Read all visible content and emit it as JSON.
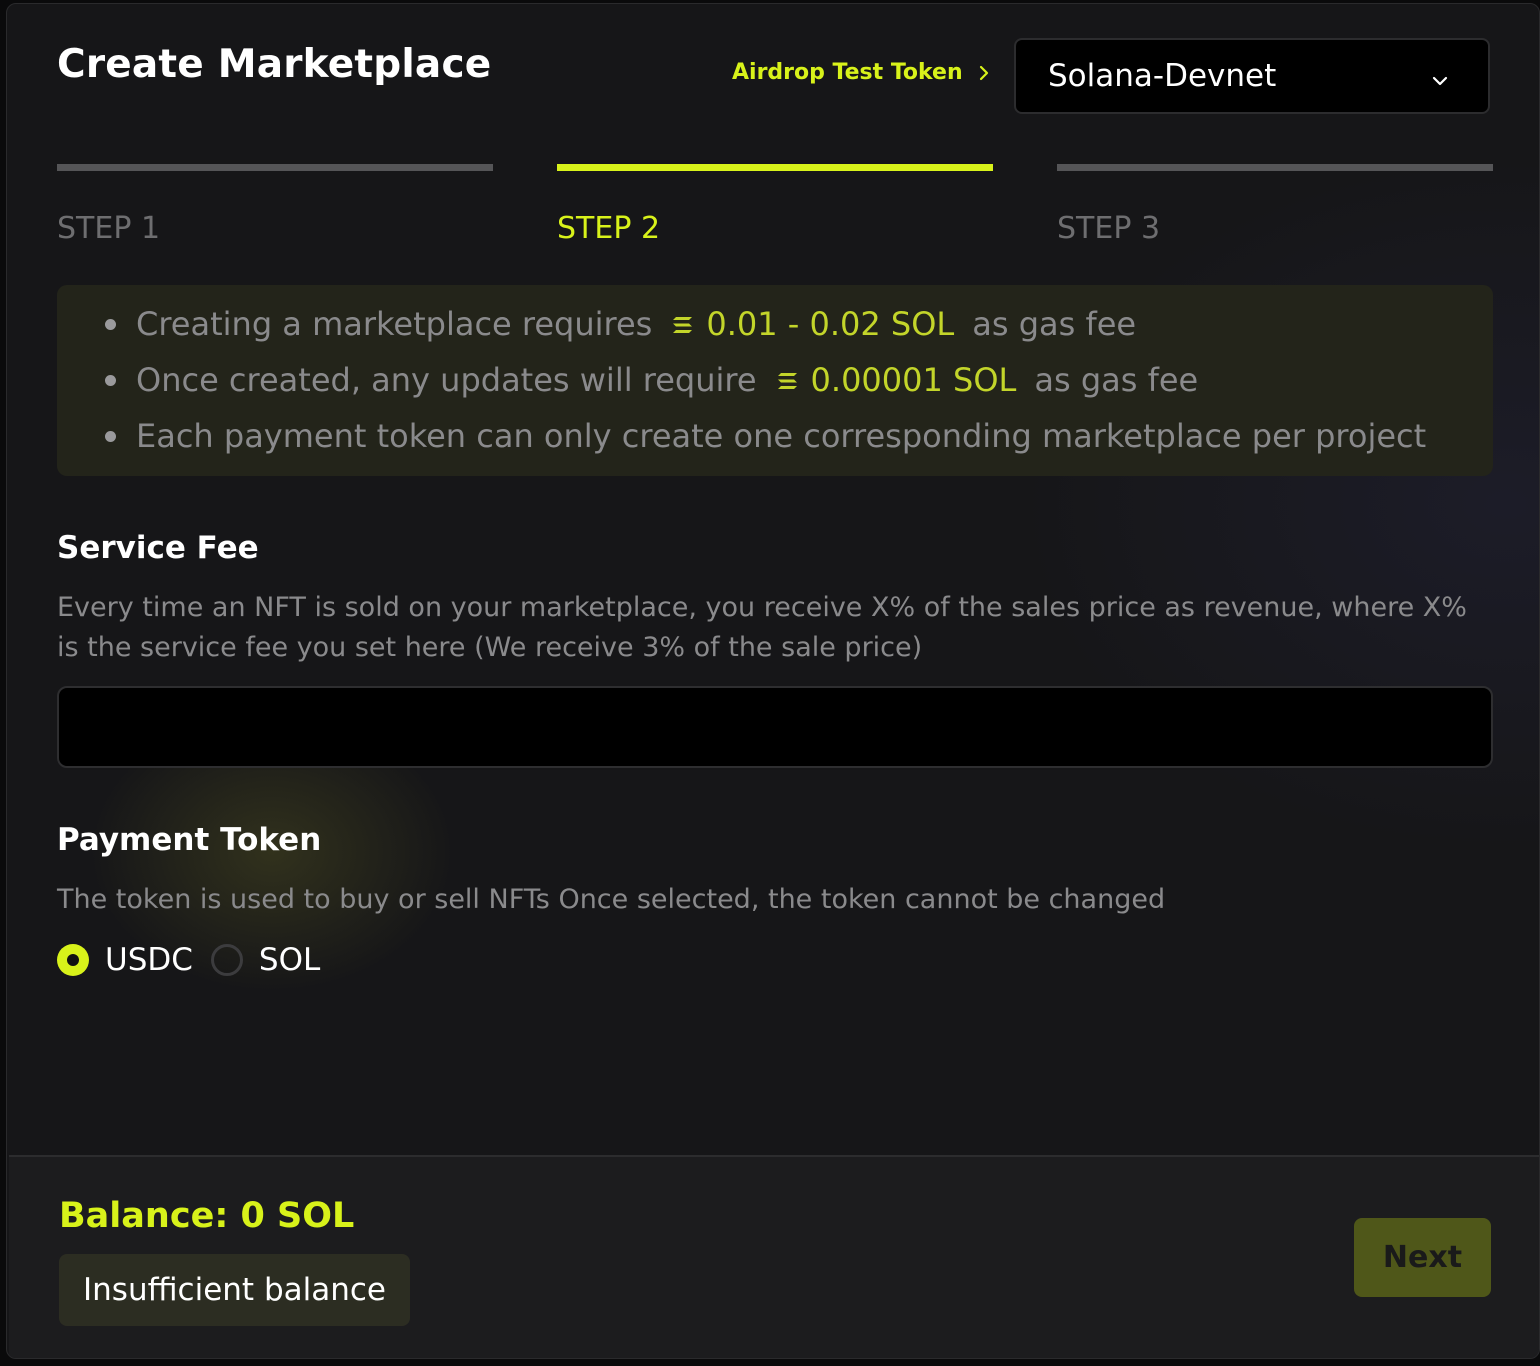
{
  "header": {
    "title": "Create Marketplace",
    "airdrop_link": "Airdrop Test Token",
    "network": "Solana-Devnet"
  },
  "steps": [
    {
      "label": "STEP 1",
      "active": false
    },
    {
      "label": "STEP 2",
      "active": true
    },
    {
      "label": "STEP 3",
      "active": false
    }
  ],
  "info": {
    "line1_prefix": "Creating a marketplace requires",
    "line1_amount": "0.01 - 0.02 SOL",
    "line1_suffix": "as gas fee",
    "line2_prefix": "Once created, any updates will require",
    "line2_amount": "0.00001 SOL",
    "line2_suffix": "as gas fee",
    "line3": "Each payment token can only create one corresponding marketplace per project"
  },
  "service_fee": {
    "title": "Service Fee",
    "description": "Every time an NFT is sold on your marketplace, you receive X% of the sales price as revenue, where X% is the service fee you set here (We receive 3% of the sale price)",
    "value": ""
  },
  "payment_token": {
    "title": "Payment Token",
    "description": "The token is used to buy or sell NFTs Once selected, the token cannot be changed",
    "options": [
      {
        "label": "USDC",
        "selected": true
      },
      {
        "label": "SOL",
        "selected": false
      }
    ]
  },
  "footer": {
    "balance": "Balance: 0 SOL",
    "status": "Insufficient balance",
    "next_label": "Next"
  },
  "colors": {
    "accent": "#d8f21a",
    "muted_text": "#8a8a8c",
    "background": "#161618"
  },
  "icons": {
    "chevron_right": "chevron-right-icon",
    "chevron_down": "chevron-down-icon",
    "solana": "solana-icon"
  }
}
